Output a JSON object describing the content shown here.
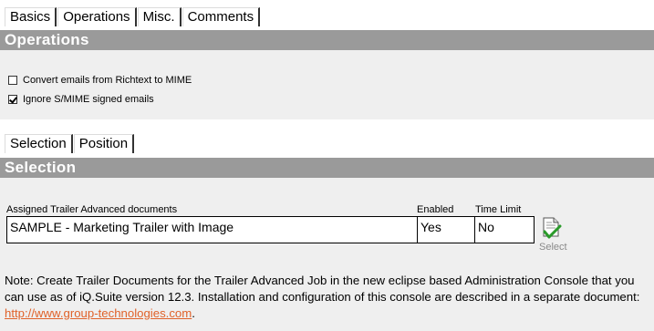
{
  "main_tabs": [
    "Basics",
    "Operations",
    "Misc.",
    "Comments"
  ],
  "operations": {
    "header": "Operations",
    "options": [
      {
        "label": "Convert emails from Richtext to MIME",
        "checked": false
      },
      {
        "label": "Ignore S/MIME signed emails",
        "checked": true
      }
    ]
  },
  "sub_tabs": [
    "Selection",
    "Position"
  ],
  "selection": {
    "header": "Selection",
    "columns": {
      "documents": "Assigned Trailer Advanced documents",
      "enabled": "Enabled",
      "time_limit": "Time Limit"
    },
    "row": {
      "document": "SAMPLE - Marketing Trailer with Image",
      "enabled": "Yes",
      "time_limit": "No"
    },
    "select_label": "Select",
    "select_icon": "document-check-icon"
  },
  "note": {
    "text": "Note: Create Trailer Documents for the Trailer Advanced Job in the new eclipse based Administration Console that you can use as of iQ.Suite version 12.3. Installation and configuration of this console are described in a separate document: ",
    "link": "http://www.group-technologies.com",
    "suffix": "."
  },
  "colors": {
    "header_bar": "#9a9a9a",
    "panel": "#efefef",
    "link": "#e0622a"
  }
}
